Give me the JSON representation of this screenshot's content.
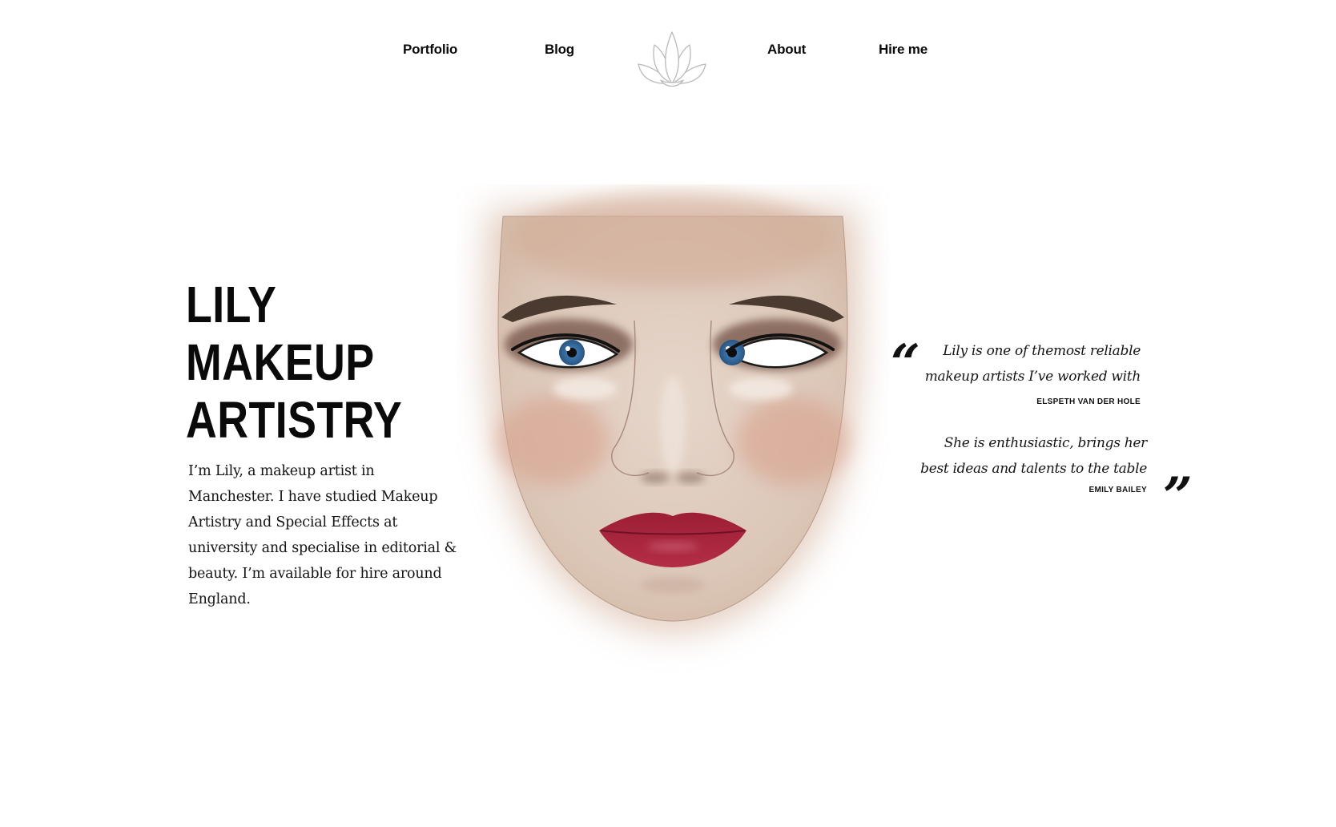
{
  "nav": {
    "items": [
      {
        "label": "Portfolio"
      },
      {
        "label": "Blog"
      },
      {
        "label": "About"
      },
      {
        "label": "Hire me"
      }
    ],
    "logo_icon": "lotus-icon"
  },
  "hero": {
    "title_lines": [
      "LILY",
      "MAKEUP",
      "ARTISTRY"
    ],
    "intro": "I’m Lily, a makeup artist in Manchester. I have studied Makeup Artistry and Special Effects at university and specialise in editorial & beauty. I’m available for hire around England."
  },
  "face_illustration": {
    "icon": "face-chart-illustration",
    "colors": {
      "skin": "#e4d2c6",
      "lips": "#a0233b",
      "iris": "#4a86b8",
      "brows": "#4a3a30"
    }
  },
  "testimonials": [
    {
      "quote": "Lily is one of themost reliable makeup artists I’ve worked with",
      "author": "ELSPETH VAN DER HOLE"
    },
    {
      "quote": "She is enthusiastic, brings her best ideas and talents to the table",
      "author": "EMILY BAILEY"
    }
  ],
  "quote_marks": {
    "open": "“",
    "close": "”"
  }
}
